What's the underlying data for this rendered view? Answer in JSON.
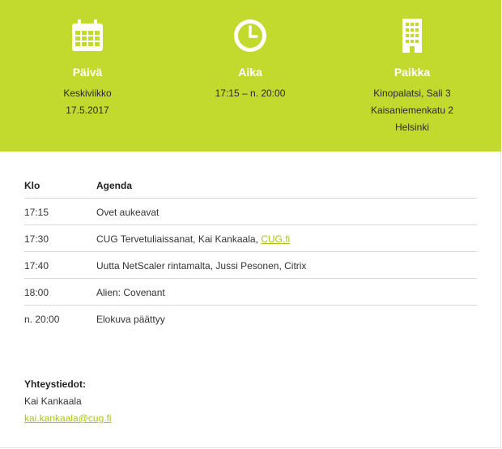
{
  "colors": {
    "banner": "#c2d92e",
    "link": "#aac21f",
    "white": "#ffffff"
  },
  "info": {
    "date": {
      "icon": "calendar-icon",
      "heading": "Päivä",
      "lines": [
        "Keskiviikko",
        "17.5.2017"
      ]
    },
    "time": {
      "icon": "clock-icon",
      "heading": "Aika",
      "lines": [
        "17:15 – n. 20:00"
      ]
    },
    "place": {
      "icon": "building-icon",
      "heading": "Paikka",
      "lines": [
        "Kinopalatsi, Sali 3",
        "Kaisaniemenkatu 2",
        "Helsinki"
      ]
    }
  },
  "agenda": {
    "headers": {
      "time": "Klo",
      "item": "Agenda"
    },
    "rows": [
      {
        "time": "17:15",
        "item": "Ovet aukeavat"
      },
      {
        "time": "17:30",
        "item": "CUG Tervetuliaissanat, Kai Kankaala, ",
        "link": "CUG.fi"
      },
      {
        "time": "17:40",
        "item": "Uutta NetScaler rintamalta, Jussi Pesonen, Citrix"
      },
      {
        "time": "18:00",
        "item": "Alien: Covenant"
      },
      {
        "time": "n. 20:00",
        "item": "Elokuva päättyy"
      }
    ]
  },
  "contact": {
    "title": "Yhteystiedot:",
    "name": "Kai Kankaala",
    "email": "kai.kankaala@cug.fi"
  }
}
